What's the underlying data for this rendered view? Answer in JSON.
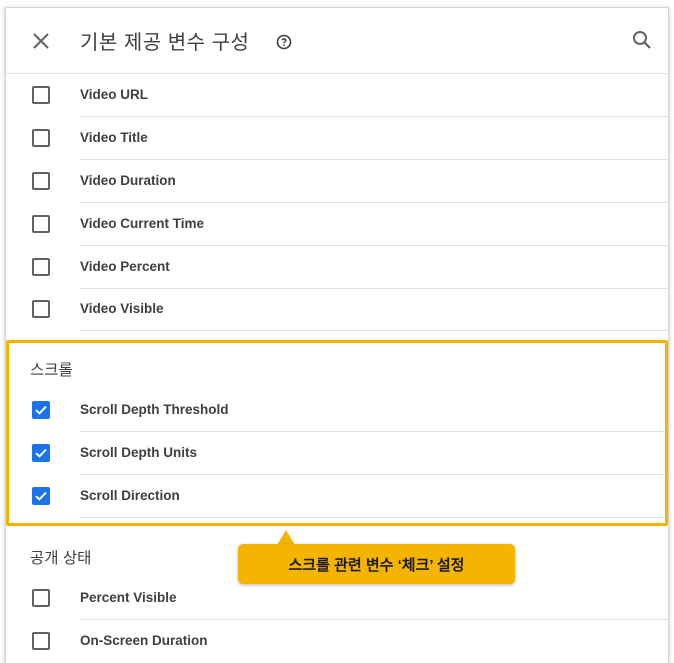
{
  "header": {
    "title": "기본 제공 변수 구성"
  },
  "icons": {
    "close": "close-icon",
    "help": "help-circle-icon",
    "search": "search-icon",
    "check": "check-icon"
  },
  "video_items": [
    {
      "label": "Video URL",
      "checked": false
    },
    {
      "label": "Video Title",
      "checked": false
    },
    {
      "label": "Video Duration",
      "checked": false
    },
    {
      "label": "Video Current Time",
      "checked": false
    },
    {
      "label": "Video Percent",
      "checked": false
    },
    {
      "label": "Video Visible",
      "checked": false
    }
  ],
  "scroll_section": {
    "title": "스크롤",
    "items": [
      {
        "label": "Scroll Depth Threshold",
        "checked": true
      },
      {
        "label": "Scroll Depth Units",
        "checked": true
      },
      {
        "label": "Scroll Direction",
        "checked": true
      }
    ]
  },
  "visibility_section": {
    "title": "공개 상태",
    "items": [
      {
        "label": "Percent Visible",
        "checked": false
      },
      {
        "label": "On-Screen Duration",
        "checked": false
      }
    ]
  },
  "annotation": {
    "callout_text": "스크롤 관련 변수 ‘체크’ 설정"
  },
  "colors": {
    "accent": "#1a73e8",
    "highlight": "#f5b400"
  }
}
